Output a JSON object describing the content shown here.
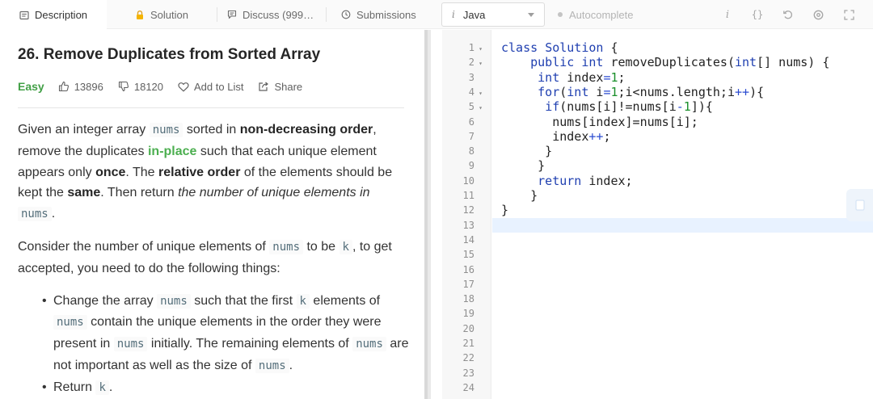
{
  "tabs": [
    {
      "label": "Description",
      "icon": "description-icon",
      "active": true
    },
    {
      "label": "Solution",
      "icon": "lock-icon",
      "active": false
    },
    {
      "label": "Discuss (999…",
      "icon": "discuss-icon",
      "active": false
    },
    {
      "label": "Submissions",
      "icon": "clock-icon",
      "active": false
    }
  ],
  "editor_toolbar": {
    "language": "Java",
    "autocomplete_label": "Autocomplete",
    "icons": [
      "info-icon",
      "braces-icon",
      "reset-icon",
      "settings-icon",
      "fullscreen-icon"
    ]
  },
  "problem": {
    "title": "26. Remove Duplicates from Sorted Array",
    "difficulty": "Easy",
    "likes": "13896",
    "dislikes": "18120",
    "add_to_list": "Add to List",
    "share": "Share"
  },
  "description": {
    "p1": {
      "t1": "Given an integer array ",
      "c1": "nums",
      "t2": " sorted in ",
      "b1": "non-decreasing order",
      "t3": ", remove the duplicates ",
      "h1": "in-place",
      "t4": " such that each unique element appears only ",
      "b2": "once",
      "t5": ". The ",
      "b3": "relative order",
      "t6": " of the elements should be kept the ",
      "b4": "same",
      "t7": ". Then return ",
      "i1": "the number of unique elements in",
      "c2": "nums",
      "t8": "."
    },
    "p2": {
      "t1": "Consider the number of unique elements of ",
      "c1": "nums",
      "t2": " to be ",
      "c2": "k",
      "t3": ", to get accepted, you need to do the following things:"
    },
    "li1": {
      "t1": "Change the array ",
      "c1": "nums",
      "t2": " such that the first ",
      "c2": "k",
      "t3": " elements of ",
      "c3": "nums",
      "t4": " contain the unique elements in the order they were present in ",
      "c4": "nums",
      "t5": " initially. The remaining elements of ",
      "c5": "nums",
      "t6": " are not important as well as the size of ",
      "c6": "nums",
      "t7": "."
    },
    "li2": {
      "t1": "Return ",
      "c1": "k",
      "t2": "."
    }
  },
  "code": {
    "line_numbers": [
      "1",
      "2",
      "3",
      "4",
      "5",
      "6",
      "7",
      "8",
      "9",
      "10",
      "11",
      "12",
      "13",
      "14",
      "15",
      "16",
      "17",
      "18",
      "19",
      "20",
      "21",
      "22",
      "23",
      "24"
    ],
    "lines": [
      {
        "n": "1",
        "text": "class Solution {"
      },
      {
        "n": "2",
        "text": "    public int removeDuplicates(int[] nums) {"
      },
      {
        "n": "3",
        "text": "     int index=1;"
      },
      {
        "n": "4",
        "text": "     for(int i=1;i<nums.length;i++){"
      },
      {
        "n": "5",
        "text": "      if(nums[i]!=nums[i-1]){"
      },
      {
        "n": "6",
        "text": "       nums[index]=nums[i];"
      },
      {
        "n": "7",
        "text": "       index++;"
      },
      {
        "n": "8",
        "text": "      }"
      },
      {
        "n": "9",
        "text": "     }"
      },
      {
        "n": "10",
        "text": "     return index;"
      },
      {
        "n": "11",
        "text": "    }"
      },
      {
        "n": "12",
        "text": "}"
      }
    ]
  }
}
